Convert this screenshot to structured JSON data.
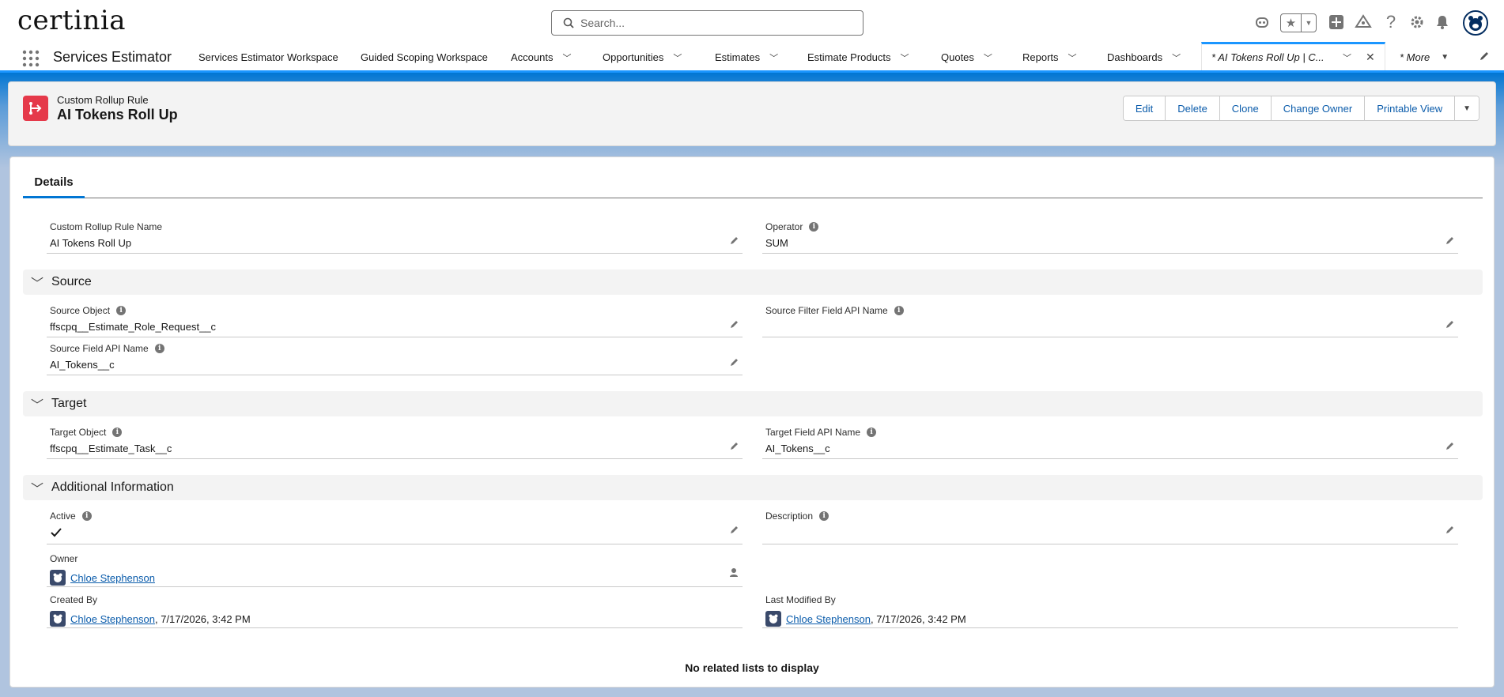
{
  "header": {
    "logo": "certinia",
    "search_placeholder": "Search..."
  },
  "nav": {
    "app_name": "Services Estimator",
    "items": [
      {
        "label": "Services Estimator Workspace",
        "dropdown": false
      },
      {
        "label": "Guided Scoping Workspace",
        "dropdown": false
      },
      {
        "label": "Accounts",
        "dropdown": true
      },
      {
        "label": "Opportunities",
        "dropdown": true
      },
      {
        "label": "Estimates",
        "dropdown": true
      },
      {
        "label": "Estimate Products",
        "dropdown": true
      },
      {
        "label": "Quotes",
        "dropdown": true
      },
      {
        "label": "Reports",
        "dropdown": true
      },
      {
        "label": "Dashboards",
        "dropdown": true
      }
    ],
    "active_tab": "* AI Tokens Roll Up | C...",
    "more": "* More"
  },
  "record": {
    "type": "Custom Rollup Rule",
    "title": "AI Tokens Roll Up",
    "actions": [
      "Edit",
      "Delete",
      "Clone",
      "Change Owner",
      "Printable View"
    ]
  },
  "details": {
    "tab": "Details",
    "rule_name_label": "Custom Rollup Rule Name",
    "rule_name": "AI Tokens Roll Up",
    "operator_label": "Operator",
    "operator": "SUM",
    "sections": {
      "source": "Source",
      "target": "Target",
      "additional": "Additional Information"
    },
    "source_object_label": "Source Object",
    "source_object": "ffscpq__Estimate_Role_Request__c",
    "source_filter_label": "Source Filter Field API Name",
    "source_filter": "",
    "source_field_label": "Source Field API Name",
    "source_field": "AI_Tokens__c",
    "target_object_label": "Target Object",
    "target_object": "ffscpq__Estimate_Task__c",
    "target_field_label": "Target Field API Name",
    "target_field": "AI_Tokens__c",
    "active_label": "Active",
    "active": true,
    "description_label": "Description",
    "description": "",
    "owner_label": "Owner",
    "owner": "Chloe Stephenson",
    "created_by_label": "Created By",
    "created_by": "Chloe Stephenson",
    "created_date": ", 7/17/2026, 3:42 PM",
    "modified_by_label": "Last Modified By",
    "modified_by": "Chloe Stephenson",
    "modified_date": ", 7/17/2026, 3:42 PM",
    "no_related": "No related lists to display"
  }
}
